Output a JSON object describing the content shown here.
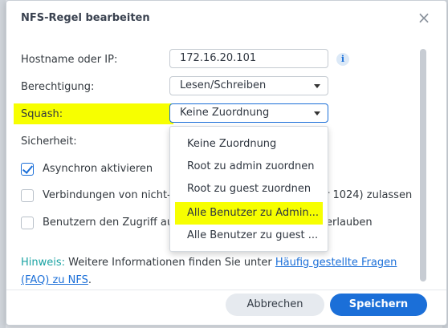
{
  "dialog": {
    "title": "NFS-Regel bearbeiten",
    "close_icon": "close-icon"
  },
  "form": {
    "hostname": {
      "label": "Hostname oder IP:",
      "value": "172.16.20.101",
      "info_icon": "info-icon",
      "info_glyph": "i"
    },
    "permission": {
      "label": "Berechtigung:",
      "value": "Lesen/Schreiben"
    },
    "squash": {
      "label": "Squash:",
      "value": "Keine Zuordnung"
    },
    "security": {
      "label": "Sicherheit:"
    },
    "checkboxes": [
      {
        "label": "Asynchron aktivieren",
        "checked": true
      },
      {
        "label": "Verbindungen von nicht-",
        "suffix": "r 1024) zulassen",
        "checked": false
      },
      {
        "label": "Benutzern den Zugriff au",
        "suffix": "erlauben",
        "checked": false
      }
    ]
  },
  "dropdown": {
    "options": [
      "Keine Zuordnung",
      "Root zu admin zuordnen",
      "Root zu guest zuordnen",
      "Alle Benutzer zu Admin...",
      "Alle Benutzer zu guest ..."
    ],
    "highlighted_index": 3
  },
  "hint": {
    "label": "Hinweis:",
    "text": " Weitere Informationen finden Sie unter ",
    "link_line1": "Häufig gestellte Fragen",
    "link_line2": "(FAQ) zu NFS",
    "end": "."
  },
  "footer": {
    "cancel_label": "Abbrechen",
    "save_label": "Speichern"
  },
  "colors": {
    "accent": "#1b6fd8",
    "highlight": "#f7ff00",
    "hint_label": "#1aa3a3"
  }
}
